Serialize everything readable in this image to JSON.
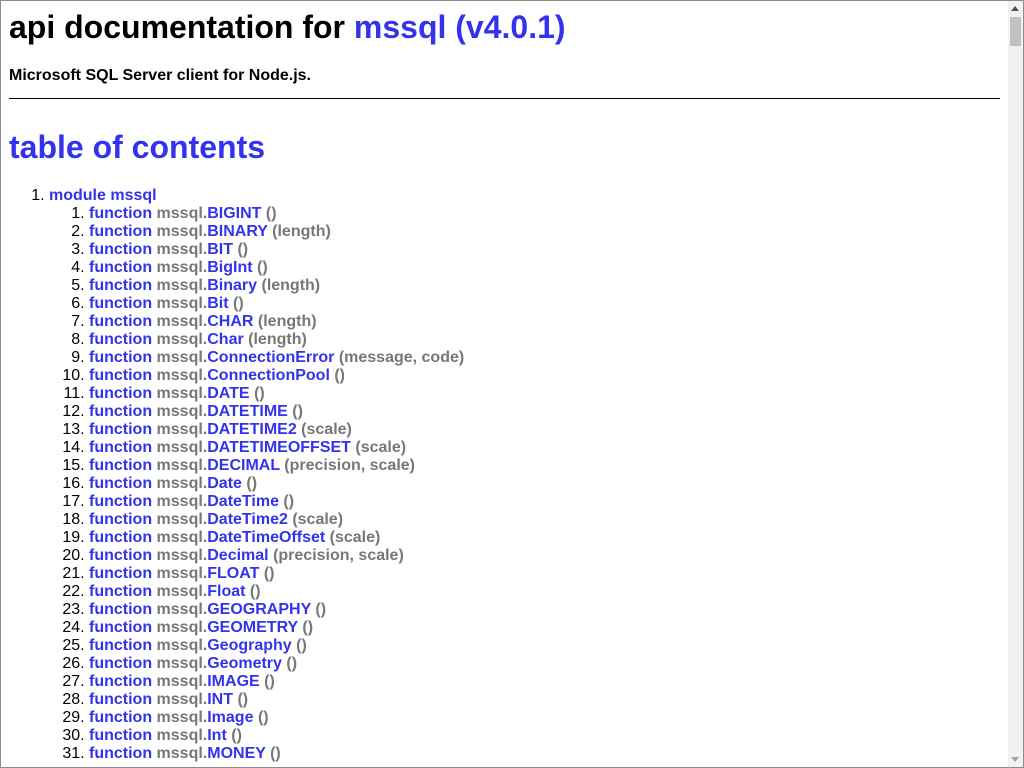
{
  "header": {
    "title_prefix": "api documentation for ",
    "title_link": "mssql (v4.0.1)",
    "description": "Microsoft SQL Server client for Node.js."
  },
  "toc": {
    "title": "table of contents",
    "module_label": "module mssql",
    "functions": [
      {
        "keyword": "function",
        "ns": "mssql.",
        "name": "BIGINT",
        "args": "()"
      },
      {
        "keyword": "function",
        "ns": "mssql.",
        "name": "BINARY",
        "args": "(length)"
      },
      {
        "keyword": "function",
        "ns": "mssql.",
        "name": "BIT",
        "args": "()"
      },
      {
        "keyword": "function",
        "ns": "mssql.",
        "name": "BigInt",
        "args": "()"
      },
      {
        "keyword": "function",
        "ns": "mssql.",
        "name": "Binary",
        "args": "(length)"
      },
      {
        "keyword": "function",
        "ns": "mssql.",
        "name": "Bit",
        "args": "()"
      },
      {
        "keyword": "function",
        "ns": "mssql.",
        "name": "CHAR",
        "args": "(length)"
      },
      {
        "keyword": "function",
        "ns": "mssql.",
        "name": "Char",
        "args": "(length)"
      },
      {
        "keyword": "function",
        "ns": "mssql.",
        "name": "ConnectionError",
        "args": "(message, code)"
      },
      {
        "keyword": "function",
        "ns": "mssql.",
        "name": "ConnectionPool",
        "args": "()"
      },
      {
        "keyword": "function",
        "ns": "mssql.",
        "name": "DATE",
        "args": "()"
      },
      {
        "keyword": "function",
        "ns": "mssql.",
        "name": "DATETIME",
        "args": "()"
      },
      {
        "keyword": "function",
        "ns": "mssql.",
        "name": "DATETIME2",
        "args": "(scale)"
      },
      {
        "keyword": "function",
        "ns": "mssql.",
        "name": "DATETIMEOFFSET",
        "args": "(scale)"
      },
      {
        "keyword": "function",
        "ns": "mssql.",
        "name": "DECIMAL",
        "args": "(precision, scale)"
      },
      {
        "keyword": "function",
        "ns": "mssql.",
        "name": "Date",
        "args": "()"
      },
      {
        "keyword": "function",
        "ns": "mssql.",
        "name": "DateTime",
        "args": "()"
      },
      {
        "keyword": "function",
        "ns": "mssql.",
        "name": "DateTime2",
        "args": "(scale)"
      },
      {
        "keyword": "function",
        "ns": "mssql.",
        "name": "DateTimeOffset",
        "args": "(scale)"
      },
      {
        "keyword": "function",
        "ns": "mssql.",
        "name": "Decimal",
        "args": "(precision, scale)"
      },
      {
        "keyword": "function",
        "ns": "mssql.",
        "name": "FLOAT",
        "args": "()"
      },
      {
        "keyword": "function",
        "ns": "mssql.",
        "name": "Float",
        "args": "()"
      },
      {
        "keyword": "function",
        "ns": "mssql.",
        "name": "GEOGRAPHY",
        "args": "()"
      },
      {
        "keyword": "function",
        "ns": "mssql.",
        "name": "GEOMETRY",
        "args": "()"
      },
      {
        "keyword": "function",
        "ns": "mssql.",
        "name": "Geography",
        "args": "()"
      },
      {
        "keyword": "function",
        "ns": "mssql.",
        "name": "Geometry",
        "args": "()"
      },
      {
        "keyword": "function",
        "ns": "mssql.",
        "name": "IMAGE",
        "args": "()"
      },
      {
        "keyword": "function",
        "ns": "mssql.",
        "name": "INT",
        "args": "()"
      },
      {
        "keyword": "function",
        "ns": "mssql.",
        "name": "Image",
        "args": "()"
      },
      {
        "keyword": "function",
        "ns": "mssql.",
        "name": "Int",
        "args": "()"
      },
      {
        "keyword": "function",
        "ns": "mssql.",
        "name": "MONEY",
        "args": "()"
      }
    ]
  },
  "colors": {
    "link": "#3333ee",
    "muted": "#777777",
    "text": "#000000"
  },
  "scrollbar": {
    "icons": [
      "scroll-up-arrow-icon",
      "scroll-down-arrow-icon"
    ]
  }
}
